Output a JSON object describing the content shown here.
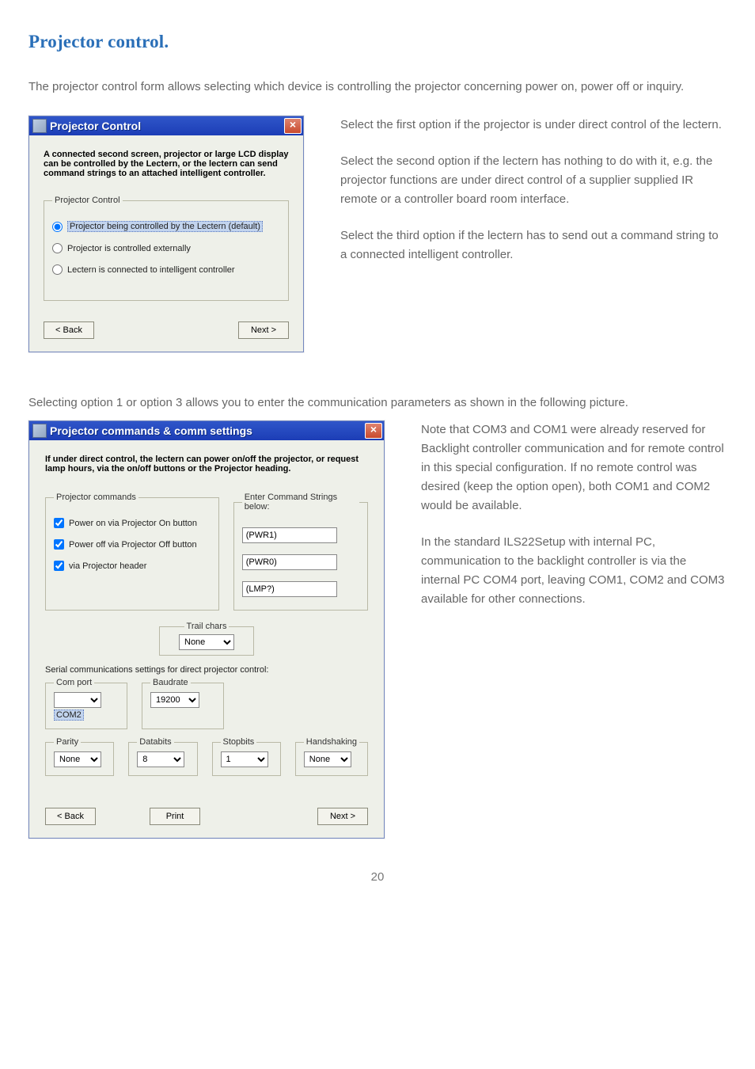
{
  "page": {
    "title": "Projector control.",
    "intro": "The projector control form allows selecting which device is controlling the projector concerning power on, power off or inquiry.",
    "right1": "Select the first option if the projector is under direct control of the lectern.",
    "right2": "Select the second option if the lectern has nothing to do with it, e.g. the projector functions are under direct control of a supplier supplied IR remote or a controller board room interface.",
    "right3": "Select the third option if the lectern has to send out a command string to a connected intelligent controller.",
    "after": "Selecting option 1 or option 3 allows you to enter the communication parameters as shown in the following picture.",
    "note1": "Note that COM3 and COM1 were already reserved for Backlight controller communication and for remote control in this special configuration. If no remote control was desired (keep the option open), both COM1 and COM2 would be available.",
    "note2": "In the standard ILS22Setup with internal PC, communication to the backlight controller is via the internal PC COM4 port, leaving COM1, COM2 and COM3 available for other connections.",
    "footer": "20"
  },
  "w1": {
    "title": "Projector Control",
    "blurb": "A connected second screen, projector or large LCD display can be controlled by the Lectern, or the lectern can send command strings to an attached intelligent controller.",
    "legend": "Projector Control",
    "opt1": "Projector being controlled by the Lectern (default)",
    "opt2": "Projector is controlled externally",
    "opt3": "Lectern is connected to intelligent controller",
    "back": "< Back",
    "next": "Next >"
  },
  "w2": {
    "title": "Projector commands & comm settings",
    "blurb": "If under direct control, the lectern can power on/off the projector, or request lamp hours, via the on/off buttons or the Projector heading.",
    "cmds_legend": "Projector commands",
    "strings_legend": "Enter Command Strings below:",
    "chk1": "Power on via Projector On button",
    "chk2": "Power off via Projector Off button",
    "chk3": "via Projector header",
    "s1": "(PWR1)",
    "s2": "(PWR0)",
    "s3": "(LMP?)",
    "trail_legend": "Trail chars",
    "trail_value": "None",
    "serial_heading": "Serial communications settings for direct projector control:",
    "com_legend": "Com port",
    "com_value": "",
    "com_item": "COM2",
    "baud_legend": "Baudrate",
    "baud_value": "19200",
    "parity_legend": "Parity",
    "parity_value": "None",
    "databits_legend": "Databits",
    "databits_value": "8",
    "stopbits_legend": "Stopbits",
    "stopbits_value": "1",
    "hand_legend": "Handshaking",
    "hand_value": "None",
    "back": "< Back",
    "print": "Print",
    "next": "Next >"
  }
}
